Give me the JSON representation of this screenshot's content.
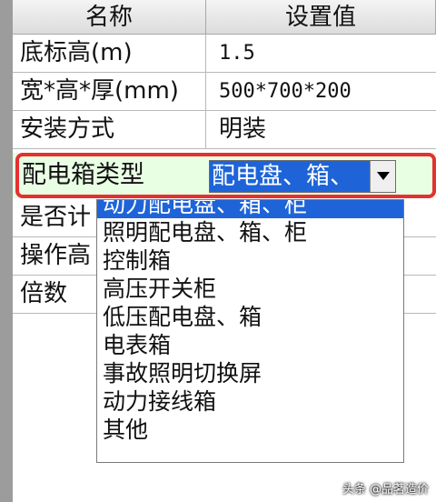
{
  "header": {
    "col_name": "名称",
    "col_value": "设置值"
  },
  "rows": [
    {
      "name": "底标高(m)",
      "value": "1.5"
    },
    {
      "name": "宽*高*厚(mm)",
      "value": "500*700*200"
    },
    {
      "name": "安装方式",
      "value": "明装"
    }
  ],
  "selected_row": {
    "name": "配电箱类型",
    "value": "配电盘、箱、"
  },
  "hidden_rows": [
    {
      "name": "是否计"
    },
    {
      "name": "操作高"
    },
    {
      "name": "倍数"
    }
  ],
  "dropdown": {
    "options": [
      "动力配电盘、箱、柜",
      "照明配电盘、箱、柜",
      "控制箱",
      "高压开关柜",
      "低压配电盘、箱",
      "电表箱",
      "事故照明切换屏",
      "动力接线箱",
      "其他"
    ],
    "selected_index": 0
  },
  "watermark": "头条 @品茗造价",
  "colors": {
    "highlight_border": "#e53030",
    "selection_blue": "#1e64d8",
    "row_tint": "#e9ffe4"
  }
}
